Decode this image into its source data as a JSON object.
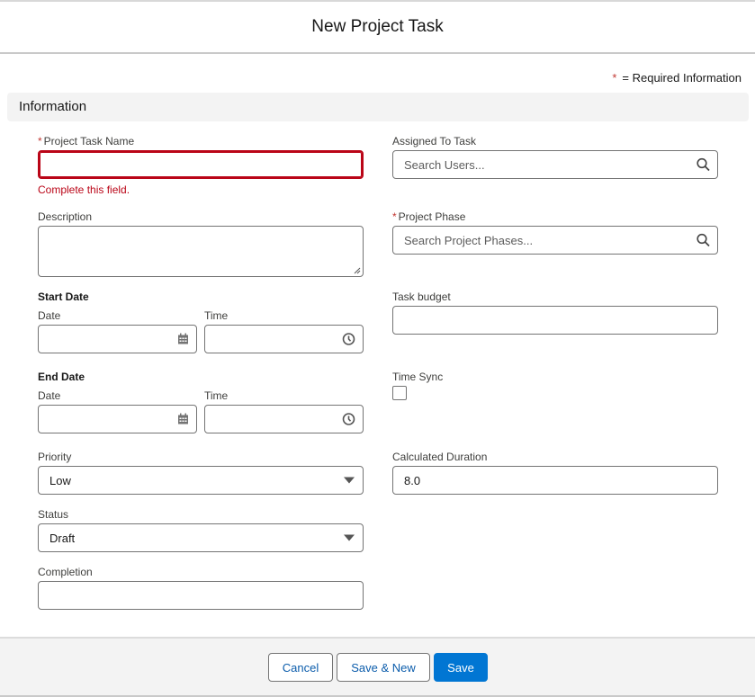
{
  "modal": {
    "title": "New Project Task",
    "required_note": "= Required Information",
    "required_star": "*"
  },
  "section": {
    "title": "Information"
  },
  "fields": {
    "task_name": {
      "label": "Project Task Name",
      "value": "",
      "error": "Complete this field."
    },
    "description": {
      "label": "Description",
      "value": ""
    },
    "start_date": {
      "label": "Start Date",
      "date_label": "Date",
      "time_label": "Time"
    },
    "end_date": {
      "label": "End Date",
      "date_label": "Date",
      "time_label": "Time"
    },
    "priority": {
      "label": "Priority",
      "value": "Low"
    },
    "status": {
      "label": "Status",
      "value": "Draft"
    },
    "completion": {
      "label": "Completion",
      "value": ""
    },
    "assigned_to": {
      "label": "Assigned To Task",
      "placeholder": "Search Users..."
    },
    "project_phase": {
      "label": "Project Phase",
      "placeholder": "Search Project Phases..."
    },
    "task_budget": {
      "label": "Task budget",
      "value": ""
    },
    "time_sync": {
      "label": "Time Sync",
      "checked": false
    },
    "calculated_duration": {
      "label": "Calculated Duration",
      "value": "8.0"
    }
  },
  "footer": {
    "cancel": "Cancel",
    "save_new": "Save & New",
    "save": "Save"
  }
}
